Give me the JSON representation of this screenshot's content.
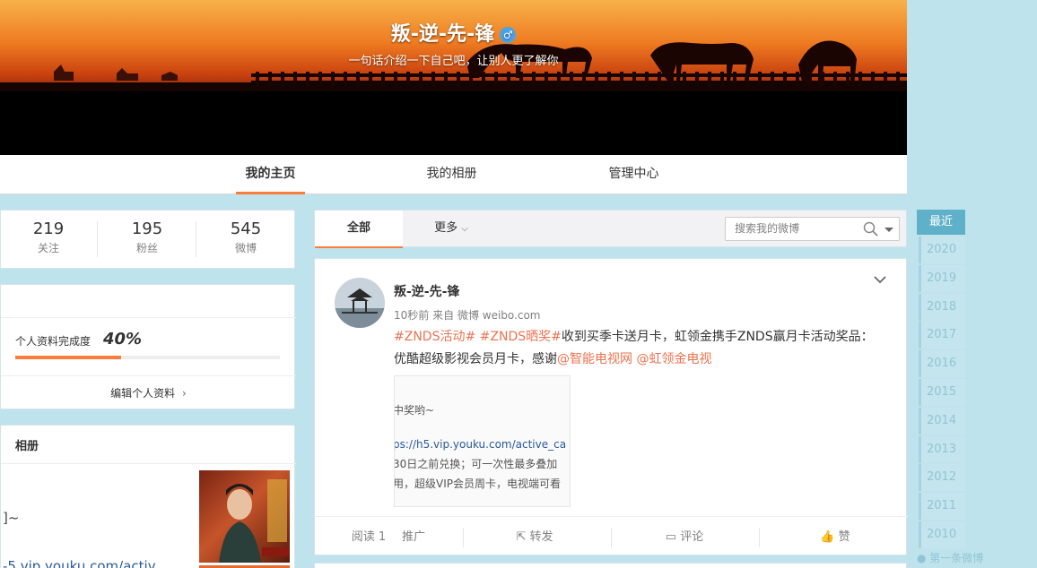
{
  "profile": {
    "nickname": "叛-逆-先-锋",
    "intro": "一句话介绍一下自己吧，让别人更了解你",
    "gender_icon": "male-icon"
  },
  "nav": {
    "tabs": [
      {
        "label": "我的主页",
        "active": true
      },
      {
        "label": "我的相册",
        "active": false
      },
      {
        "label": "管理中心",
        "active": false
      }
    ]
  },
  "counts": [
    {
      "num": "219",
      "label": "关注"
    },
    {
      "num": "195",
      "label": "粉丝"
    },
    {
      "num": "545",
      "label": "微博"
    }
  ],
  "completion": {
    "label": "个人资料完成度",
    "value": "40%",
    "fraction": 0.4,
    "edit_label": "编辑个人资料"
  },
  "album": {
    "title": "相册",
    "left_text_1": "]~",
    "left_text_2": "-5.vip.youku.com/activ"
  },
  "feed_tabs": {
    "all": "全部",
    "more": "更多",
    "search_placeholder": "搜索我的微博"
  },
  "post": {
    "author": "叛-逆-先-锋",
    "time": "10秒前",
    "source_prefix": "来自",
    "source": "微博 weibo.com",
    "tag1": "#ZNDS活动#",
    "tag2": "#ZNDS晒奖#",
    "text1": "收到买季卡送月卡，虹领金携手ZNDS赢月卡活动奖品：优酷超级影视会员月卡，感谢",
    "mention1": "@智能电视网",
    "mention2": "@虹领金电视",
    "image_lines": [
      "中奖哟~",
      "ps://h5.vip.youku.com/active_ca",
      "30日之前兑换；可一次性最多叠加",
      "用，超级VIP会员周卡，电视端可看"
    ],
    "read_label": "阅读 1",
    "promote_label": "推广",
    "forward_label": "转发",
    "comment_label": "评论",
    "like_label": "赞"
  },
  "timeline": {
    "recent": "最近",
    "years": [
      "2020",
      "2019",
      "2018",
      "2017",
      "2016",
      "2015",
      "2014",
      "2013",
      "2012",
      "2011",
      "2010"
    ],
    "first": "第一条微博"
  },
  "colors": {
    "accent": "#fa7d3c",
    "link": "#eb7350",
    "background": "#bfe3ec"
  }
}
